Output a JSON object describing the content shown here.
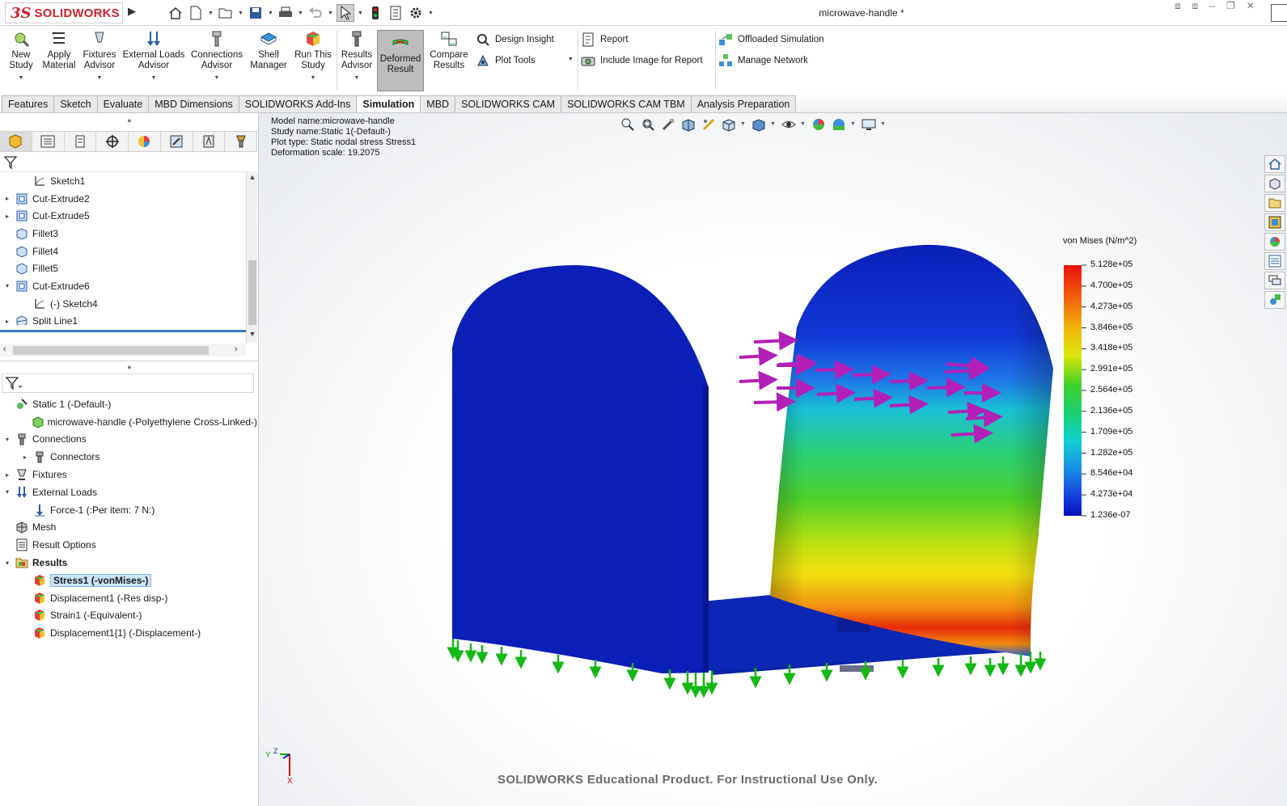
{
  "app": {
    "brand_prefix": "3S",
    "brand_name": "SOLIDWORKS"
  },
  "document": {
    "title": "microwave-handle *"
  },
  "ribbon": {
    "new_study": "New\nStudy",
    "apply_material": "Apply\nMaterial",
    "fixtures_advisor": "Fixtures\nAdvisor",
    "external_loads_advisor": "External Loads\nAdvisor",
    "connections_advisor": "Connections\nAdvisor",
    "shell_manager": "Shell\nManager",
    "run_this_study": "Run This\nStudy",
    "results_advisor": "Results\nAdvisor",
    "deformed_result": "Deformed\nResult",
    "compare_results": "Compare\nResults",
    "design_insight": "Design Insight",
    "plot_tools": "Plot Tools",
    "report": "Report",
    "include_image": "Include Image for Report",
    "offloaded_simulation": "Offloaded Simulation",
    "manage_network": "Manage Network"
  },
  "tabs": [
    "Features",
    "Sketch",
    "Evaluate",
    "MBD Dimensions",
    "SOLIDWORKS Add-Ins",
    "Simulation",
    "MBD",
    "SOLIDWORKS CAM",
    "SOLIDWORKS CAM TBM",
    "Analysis Preparation"
  ],
  "active_tab": "Simulation",
  "feature_tree": [
    {
      "label": "Sketch1",
      "expand": "",
      "icon": "sketch-icon",
      "indent": 1
    },
    {
      "label": "Cut-Extrude2",
      "expand": "▸",
      "icon": "cut-extrude-icon",
      "indent": 0
    },
    {
      "label": "Cut-Extrude5",
      "expand": "▸",
      "icon": "cut-extrude-icon",
      "indent": 0
    },
    {
      "label": "Fillet3",
      "expand": "",
      "icon": "fillet-icon",
      "indent": 0
    },
    {
      "label": "Fillet4",
      "expand": "",
      "icon": "fillet-icon",
      "indent": 0
    },
    {
      "label": "Fillet5",
      "expand": "",
      "icon": "fillet-icon",
      "indent": 0
    },
    {
      "label": "Cut-Extrude6",
      "expand": "▾",
      "icon": "cut-extrude-icon",
      "indent": 0
    },
    {
      "label": "(-) Sketch4",
      "expand": "",
      "icon": "sketch-icon",
      "indent": 1
    },
    {
      "label": "Split Line1",
      "expand": "▸",
      "icon": "split-line-icon",
      "indent": 0
    }
  ],
  "sim_tree": [
    {
      "label": "Static 1 (-Default-)",
      "expand": "",
      "icon": "study-icon",
      "indent": 0,
      "selected": false,
      "bold": false
    },
    {
      "label": "microwave-handle (-Polyethylene Cross-Linked-)",
      "expand": "",
      "icon": "part-icon",
      "indent": 1,
      "selected": false,
      "bold": false
    },
    {
      "label": "Connections",
      "expand": "▾",
      "icon": "connections-icon",
      "indent": 0,
      "selected": false,
      "bold": false
    },
    {
      "label": "Connectors",
      "expand": "▸",
      "icon": "connector-icon",
      "indent": 1,
      "selected": false,
      "bold": false
    },
    {
      "label": "Fixtures",
      "expand": "▸",
      "icon": "fixtures-icon",
      "indent": 0,
      "selected": false,
      "bold": false
    },
    {
      "label": "External Loads",
      "expand": "▾",
      "icon": "external-loads-icon",
      "indent": 0,
      "selected": false,
      "bold": false
    },
    {
      "label": "Force-1 (:Per item: 7 N:)",
      "expand": "",
      "icon": "force-icon",
      "indent": 1,
      "selected": false,
      "bold": false
    },
    {
      "label": "Mesh",
      "expand": "",
      "icon": "mesh-icon",
      "indent": 0,
      "selected": false,
      "bold": false
    },
    {
      "label": "Result Options",
      "expand": "",
      "icon": "result-options-icon",
      "indent": 0,
      "selected": false,
      "bold": false
    },
    {
      "label": "Results",
      "expand": "▾",
      "icon": "results-folder-icon",
      "indent": 0,
      "selected": false,
      "bold": true
    },
    {
      "label": "Stress1 (-vonMises-)",
      "expand": "",
      "icon": "stress-plot-icon",
      "indent": 1,
      "selected": true,
      "bold": true
    },
    {
      "label": "Displacement1 (-Res disp-)",
      "expand": "",
      "icon": "displacement-plot-icon",
      "indent": 1,
      "selected": false,
      "bold": false
    },
    {
      "label": "Strain1 (-Equivalent-)",
      "expand": "",
      "icon": "strain-plot-icon",
      "indent": 1,
      "selected": false,
      "bold": false
    },
    {
      "label": "Displacement1{1} (-Displacement-)",
      "expand": "",
      "icon": "displacement-plot-icon",
      "indent": 1,
      "selected": false,
      "bold": false
    }
  ],
  "plot_info": {
    "model_name": "Model name:microwave-handle",
    "study_name": "Study name:Static 1(-Default-)",
    "plot_type": "Plot type: Static nodal stress Stress1",
    "deformation": "Deformation scale: 19.2075"
  },
  "legend": {
    "title": "von Mises (N/m^2)",
    "labels": [
      "5.128e+05",
      "4.700e+05",
      "4.273e+05",
      "3.846e+05",
      "3.418e+05",
      "2.991e+05",
      "2.564e+05",
      "2.136e+05",
      "1.709e+05",
      "1.282e+05",
      "8.546e+04",
      "4.273e+04",
      "1.236e-07"
    ]
  },
  "watermark": "SOLIDWORKS Educational Product. For Instructional Use Only.",
  "triad": {
    "y": "Y",
    "z": "Z",
    "x": "X"
  },
  "colors": {
    "accent_red": "#d0202b",
    "tab_active": "#ffffff",
    "selection": "#cce4f7",
    "model_blue": "#0a1fb8",
    "load_arrow": "#b320b8",
    "fixture_green": "#14b814"
  }
}
